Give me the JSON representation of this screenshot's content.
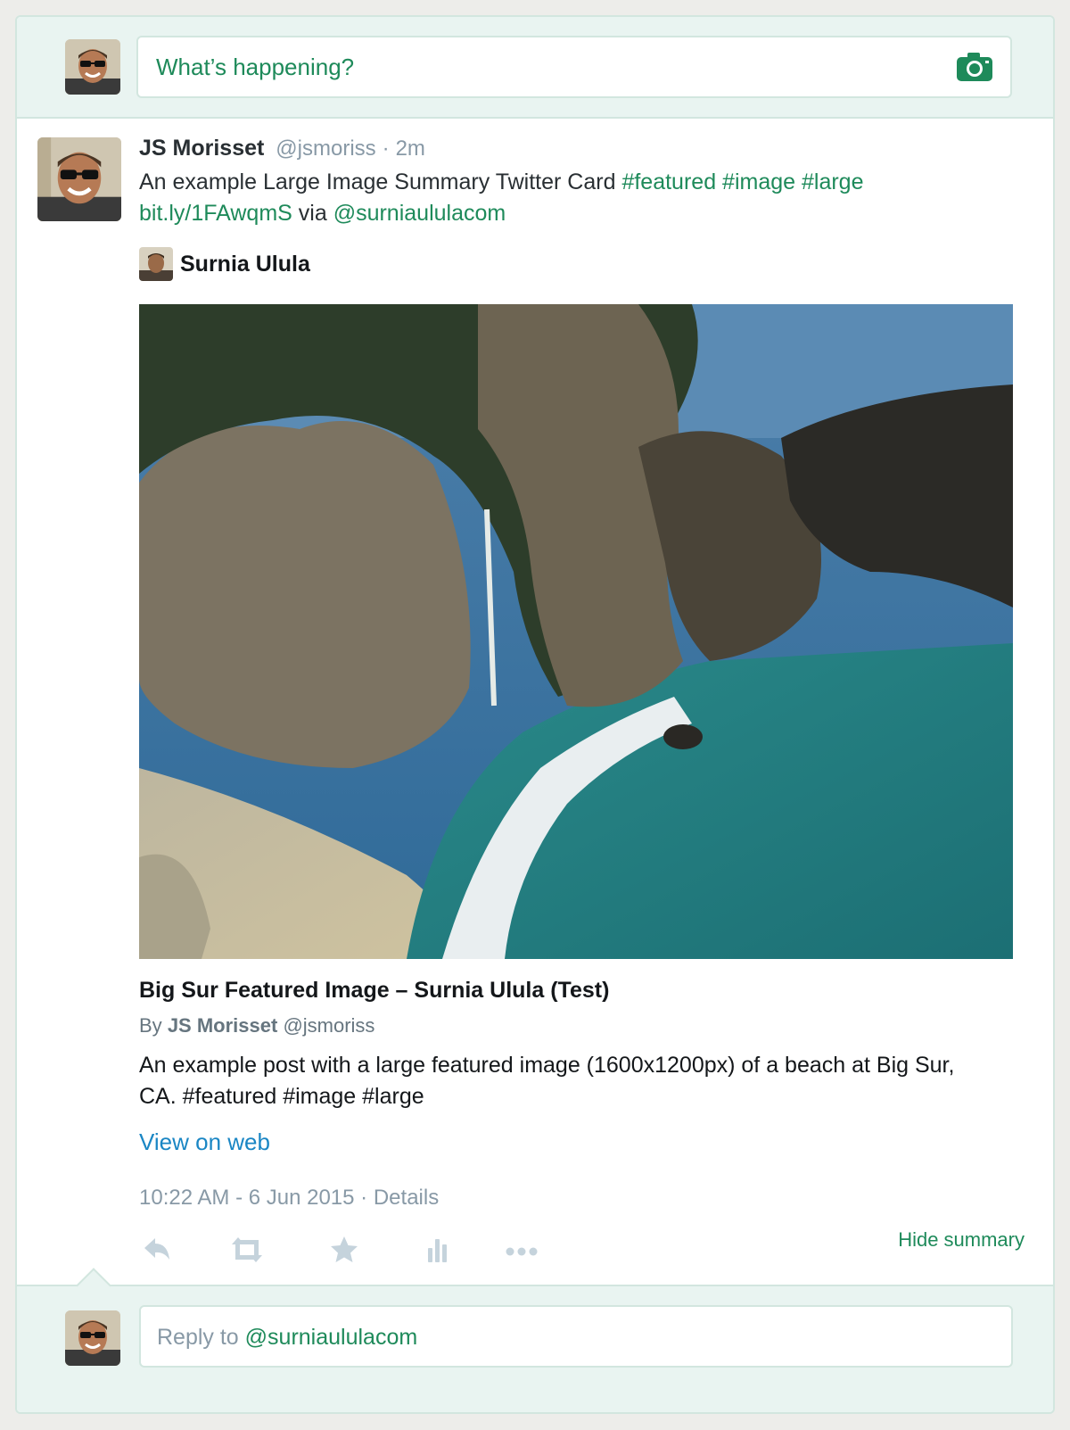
{
  "composer": {
    "placeholder": "What’s happening?",
    "camera_icon": "camera-icon"
  },
  "tweet": {
    "name": "JS Morisset",
    "handle": "@jsmoriss",
    "separator": "·",
    "age": "2m",
    "text_plain": "An example Large Image Summary Twitter Card",
    "tags": [
      "#featured",
      "#image",
      "#large"
    ],
    "link": "bit.ly/1FAwqmS",
    "via": "via",
    "mention": "@surniaululacom"
  },
  "card": {
    "site_name": "Surnia Ulula",
    "image_alt": "Big Sur beach with waterfall and cliffs",
    "title": "Big Sur Featured Image – Surnia Ulula (Test)",
    "by_label": "By",
    "author_name": "JS Morisset",
    "author_handle": "@jsmoriss",
    "description": "An example post with a large featured image (1600x1200px) of a beach at Big Sur, CA. #featured #image #large",
    "view_on_web": "View on web"
  },
  "meta": {
    "timestamp": "10:22 AM - 6 Jun 2015",
    "separator": "·",
    "details": "Details"
  },
  "actions": {
    "icons": [
      "reply-icon",
      "retweet-icon",
      "favorite-icon",
      "analytics-icon",
      "more-icon"
    ],
    "hide_summary": "Hide summary"
  },
  "reply": {
    "prefix": "Reply to",
    "mention": "@surniaululacom"
  },
  "colors": {
    "accent_green": "#1e8a5a",
    "link_blue": "#1a86c4",
    "muted": "#8899a6",
    "panel_bg": "#e9f4f1",
    "border": "#d2e6df"
  }
}
